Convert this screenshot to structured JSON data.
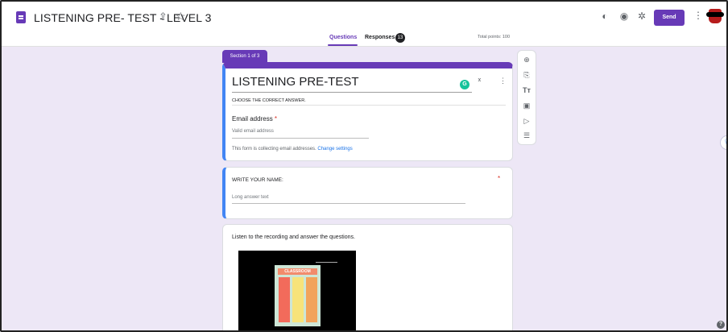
{
  "header": {
    "title": "LISTENING PRE- TEST - LEVEL 3",
    "send_label": "Send",
    "icons": [
      "forms-doc-icon",
      "move-to-folder-icon",
      "star-icon",
      "palette-icon",
      "preview-eye-icon",
      "settings-gear-icon",
      "more-vert-icon",
      "avatar"
    ]
  },
  "tabs": {
    "questions": "Questions",
    "responses": "Responses",
    "responses_count": "13",
    "total_points": "Total points: 100"
  },
  "section": {
    "label": "Section 1 of 3"
  },
  "form_header": {
    "title": "LISTENING PRE-TEST",
    "description": "CHOOSE THE CORRECT ANSWER.",
    "grammarly": "G",
    "email_label": "Email address",
    "required_mark": "*",
    "email_placeholder": "Valid email address",
    "collecting_note": "This form is collecting email addresses.",
    "change_settings": "Change settings"
  },
  "question2": {
    "title": "WRITE YOUR NAME:",
    "required_mark": "*",
    "placeholder": "Long answer text"
  },
  "question3": {
    "title": "Listen to the recording and answer the questions.",
    "poster_heading": "CLASSROOM"
  },
  "side_toolbar": {
    "icons": [
      "add-question-icon",
      "import-questions-icon",
      "add-title-icon",
      "add-image-icon",
      "add-video-icon",
      "add-section-icon"
    ]
  },
  "colors": {
    "accent": "#673ab7",
    "background": "#ede7f6",
    "active_border": "#4285f4",
    "required": "#d93025",
    "link": "#1a73e8"
  }
}
